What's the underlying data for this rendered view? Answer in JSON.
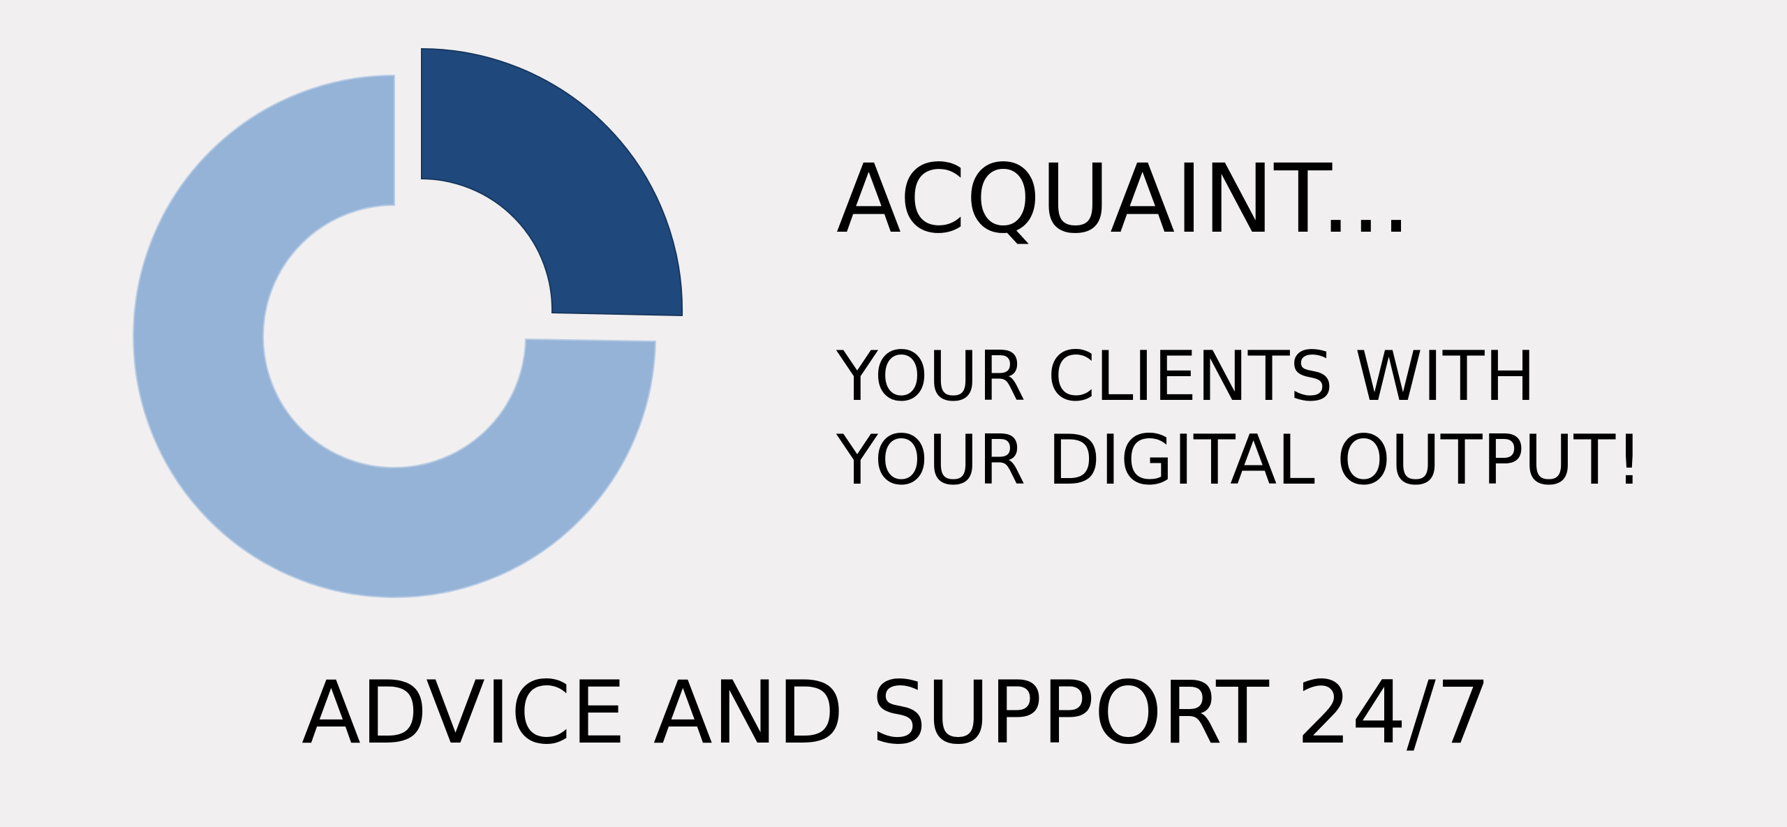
{
  "headline": "ACQUAINT...",
  "subtext": {
    "line1": "YOUR CLIENTS WITH",
    "line2": "YOUR DIGITAL OUTPUT!"
  },
  "footer": "ADVICE AND SUPPORT 24/7",
  "graphic": {
    "type": "donut-decoration",
    "segments": [
      {
        "fraction": 0.25,
        "color": "#1f497d",
        "exploded": true
      },
      {
        "fraction": 0.75,
        "color": "#95b3d7",
        "exploded": false
      }
    ]
  }
}
